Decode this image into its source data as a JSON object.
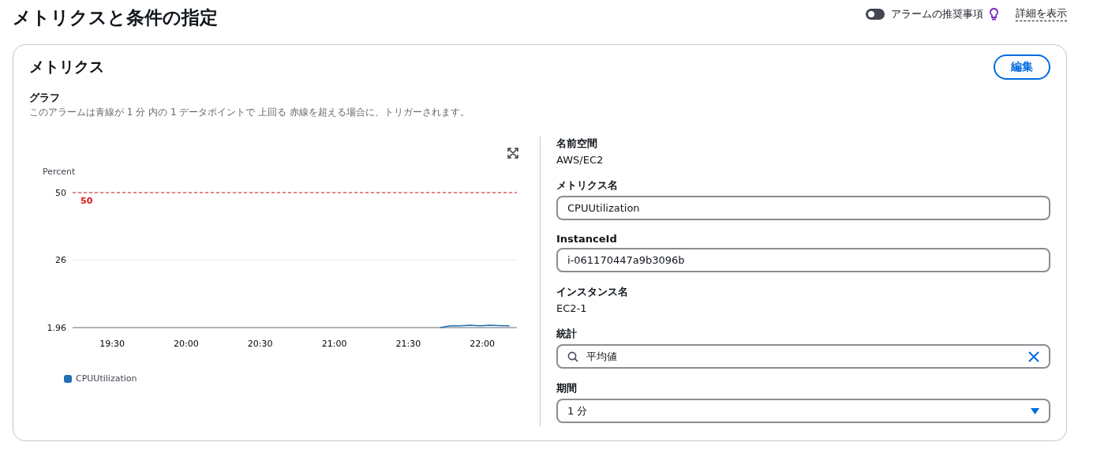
{
  "page_title": "メトリクスと条件の指定",
  "header_actions": {
    "toggle": {
      "label": "アラームの推奨事項",
      "on": false
    },
    "info_link": "詳細を表示"
  },
  "card": {
    "title": "メトリクス",
    "edit_button": "編集",
    "graph": {
      "label": "グラフ",
      "description": "このアラームは青線が 1 分 内の 1 データポイントで 上回る 赤線を超える場合に、トリガーされます。",
      "chart_data": {
        "type": "line",
        "ylabel": "Percent",
        "xlim": [
          1154,
          1334
        ],
        "ylim": [
          1.96,
          50
        ],
        "x": [
          1303,
          1307,
          1311,
          1315,
          1319,
          1323,
          1327,
          1331
        ],
        "series": [
          {
            "name": "CPUUtilization",
            "color": "#1f6fb2",
            "values": [
              2,
              2.6,
              2.6,
              2.8,
              2.6,
              2.8,
              2.7,
              2.6
            ]
          }
        ],
        "xticks": [
          {
            "value": 1170,
            "label": "19:30"
          },
          {
            "value": 1200,
            "label": "20:00"
          },
          {
            "value": 1230,
            "label": "20:30"
          },
          {
            "value": 1260,
            "label": "21:00"
          },
          {
            "value": 1290,
            "label": "21:30"
          },
          {
            "value": 1320,
            "label": "22:00"
          }
        ],
        "yticks": [
          {
            "value": 1.96,
            "label": "1.96"
          },
          {
            "value": 26,
            "label": "26"
          },
          {
            "value": 50,
            "label": "50"
          }
        ],
        "ref_lines": [
          {
            "axis": "y",
            "value": 50,
            "label": "50",
            "color": "#d91515"
          }
        ]
      }
    },
    "fields": [
      {
        "kind": "text",
        "label": "名前空間",
        "value": "AWS/EC2"
      },
      {
        "kind": "input",
        "label": "メトリクス名",
        "value": "CPUUtilization"
      },
      {
        "kind": "input",
        "label": "InstanceId",
        "value": "i-061170447a9b3096b"
      },
      {
        "kind": "text",
        "label": "インスタンス名",
        "value": "EC2-1"
      },
      {
        "kind": "search",
        "label": "統計",
        "value": "平均値"
      },
      {
        "kind": "select",
        "label": "期間",
        "value": "1 分"
      }
    ]
  }
}
